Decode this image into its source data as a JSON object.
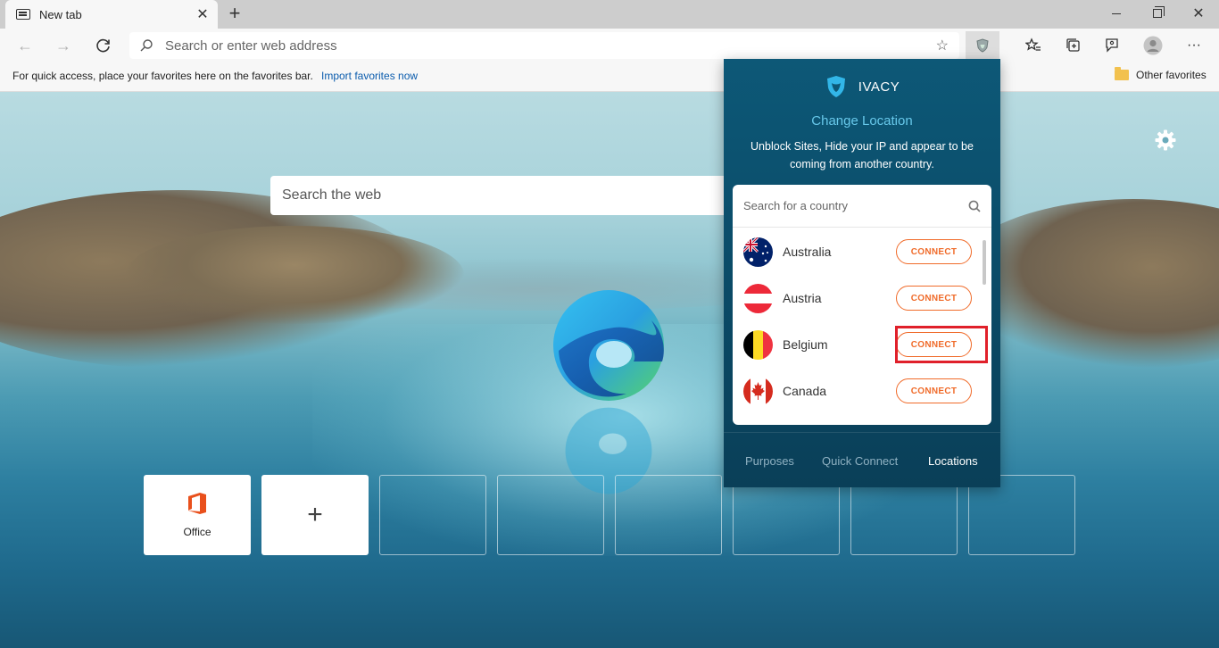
{
  "browser": {
    "tab": {
      "title": "New tab"
    },
    "address": {
      "placeholder": "Search or enter web address"
    },
    "favorites_bar": {
      "message": "For quick access, place your favorites here on the favorites bar.",
      "import_link": "Import favorites now",
      "other_favorites": "Other favorites"
    }
  },
  "new_tab": {
    "search": {
      "placeholder": "Search the web"
    },
    "tiles": [
      {
        "label": "Office",
        "type": "site"
      },
      {
        "label": "",
        "type": "add"
      }
    ]
  },
  "ivacy": {
    "brand": "IVACY",
    "heading": "Change Location",
    "subtext": "Unblock Sites, Hide your IP and appear to be coming from another country.",
    "search": {
      "placeholder": "Search for a country"
    },
    "countries": [
      {
        "name": "Australia",
        "button": "CONNECT"
      },
      {
        "name": "Austria",
        "button": "CONNECT"
      },
      {
        "name": "Belgium",
        "button": "CONNECT"
      },
      {
        "name": "Canada",
        "button": "CONNECT"
      }
    ],
    "nav": [
      {
        "label": "Purposes",
        "active": false
      },
      {
        "label": "Quick Connect",
        "active": false
      },
      {
        "label": "Locations",
        "active": true
      }
    ],
    "colors": {
      "accent": "#f06b2a",
      "heading": "#67c8ea",
      "highlight": "#e0202a"
    }
  }
}
